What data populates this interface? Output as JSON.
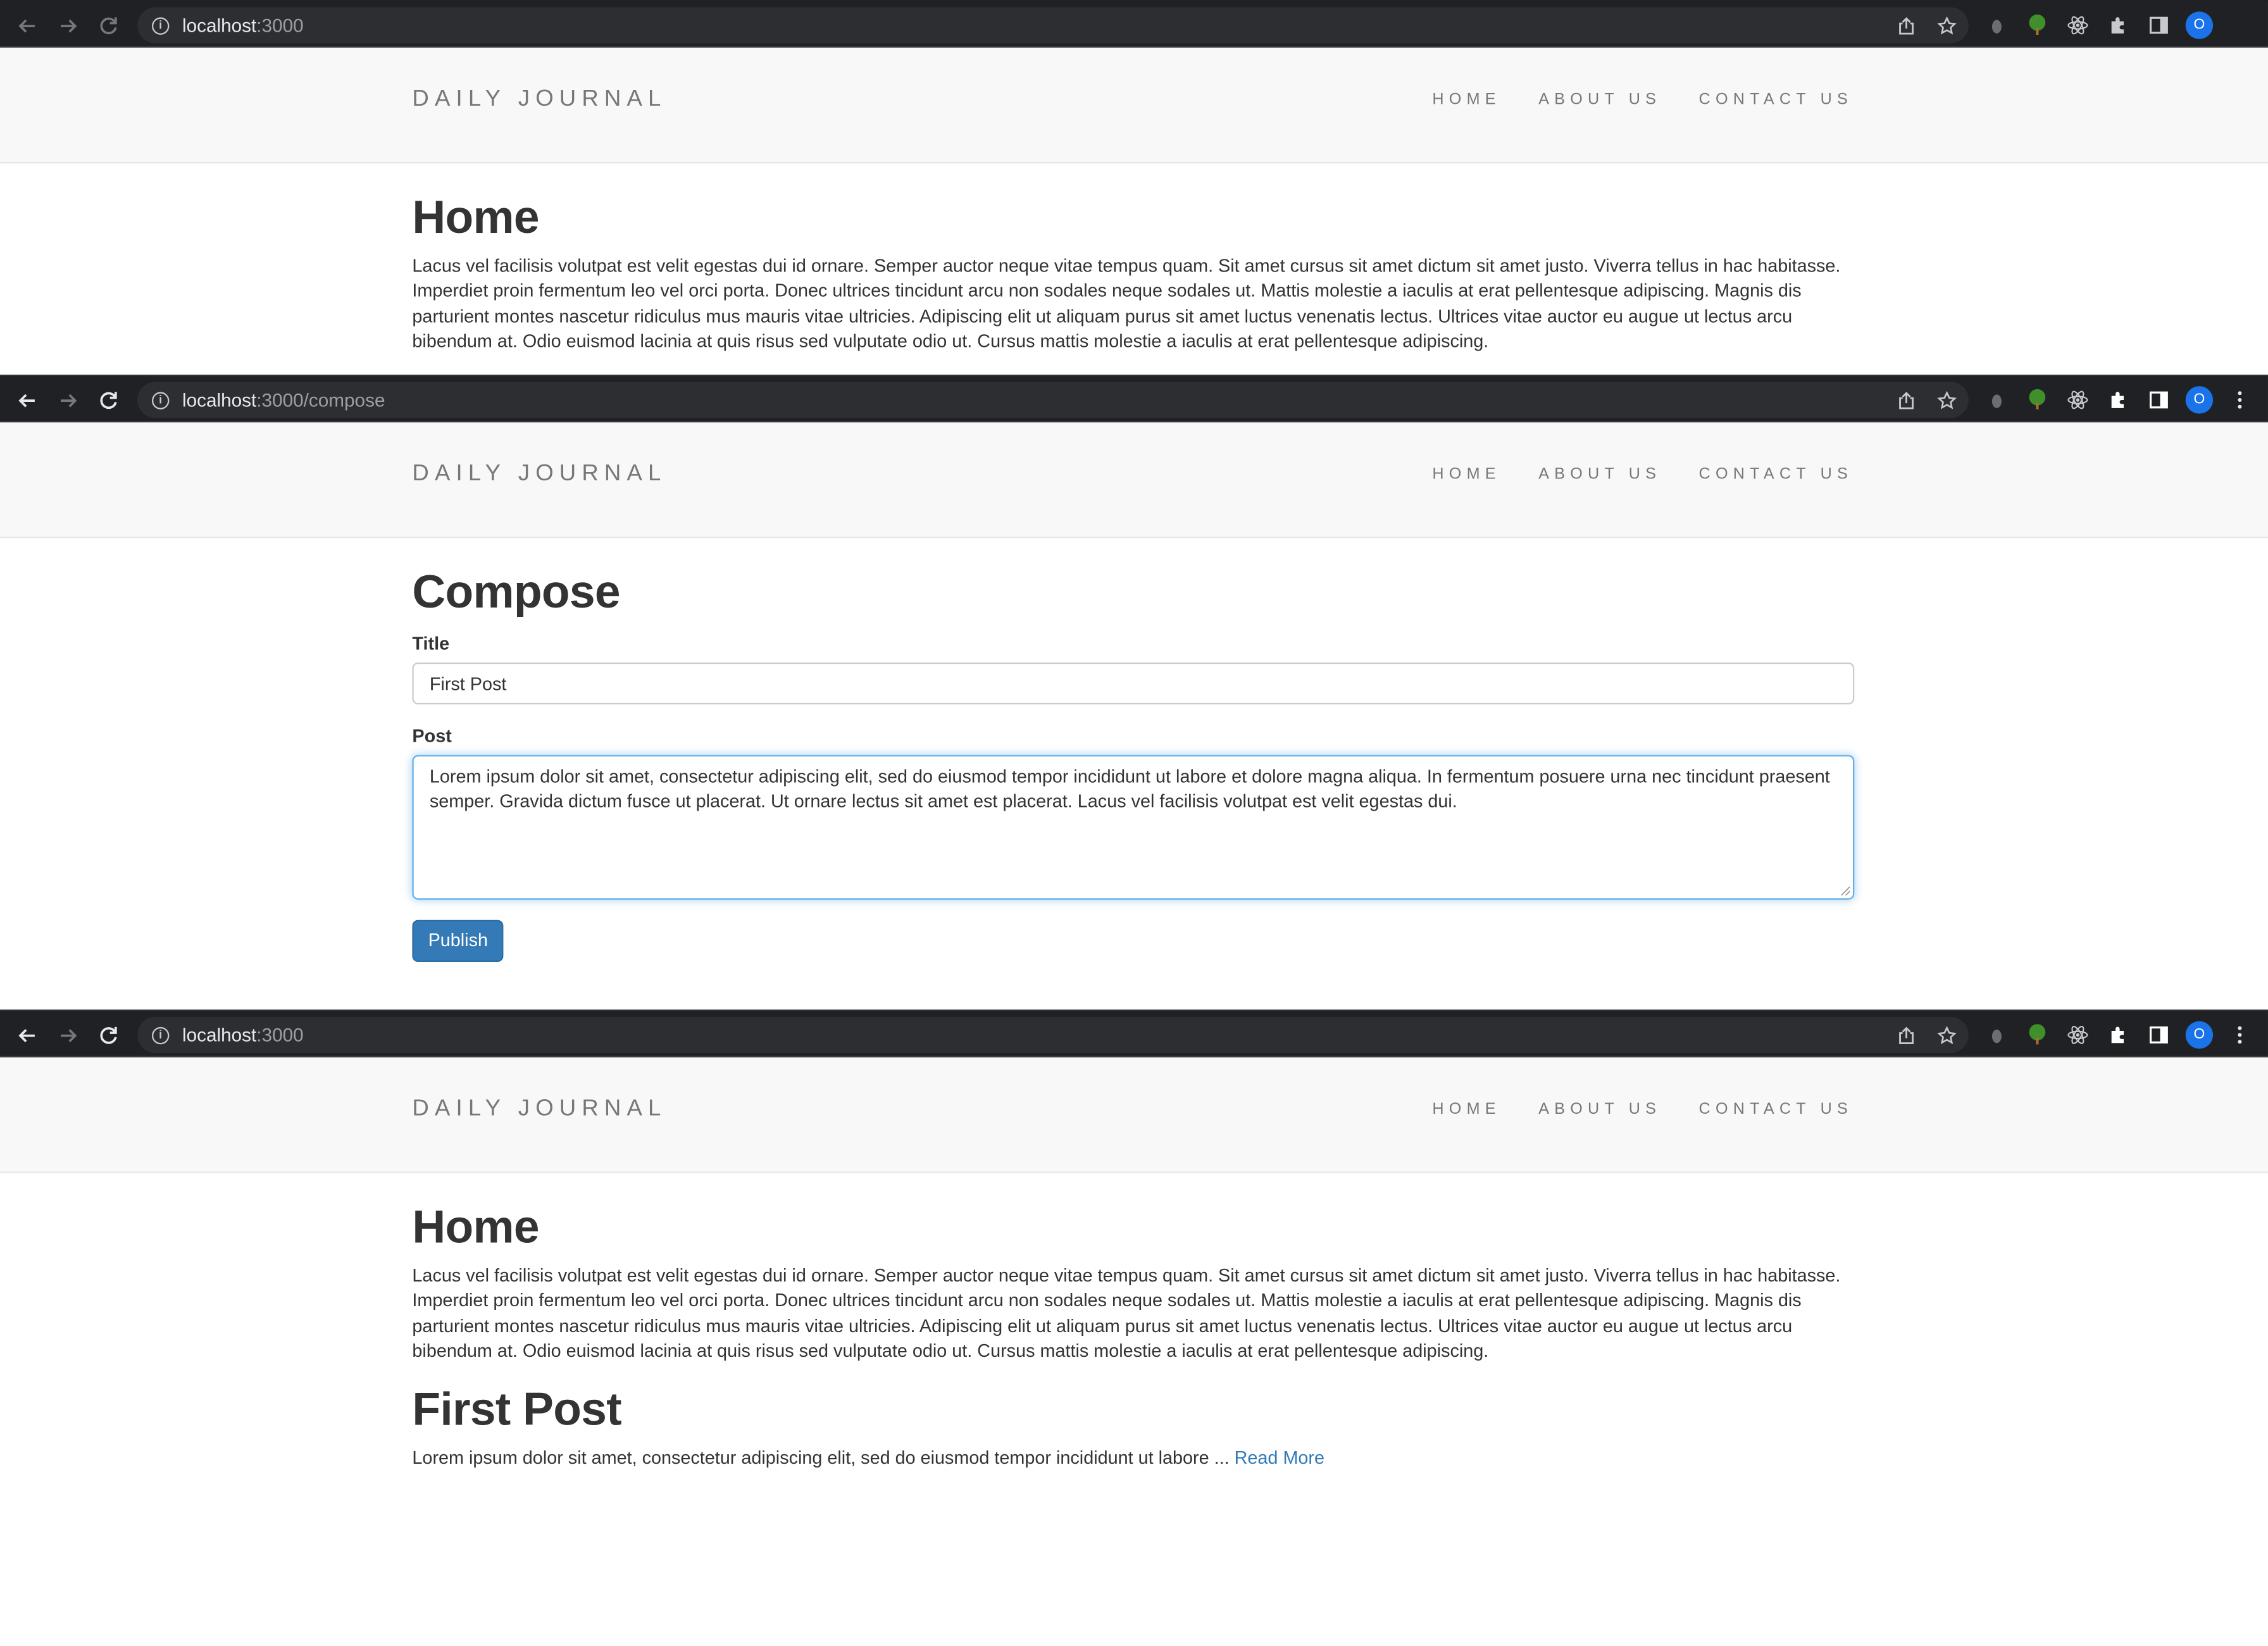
{
  "brand_title": "DAILY JOURNAL",
  "nav_links": [
    "HOME",
    "ABOUT US",
    "CONTACT US"
  ],
  "colors": {
    "chrome_bg": "#202124",
    "navbar_bg": "#f8f8f8",
    "link": "#337ab7",
    "button": "#337ab7",
    "heading": "#333333"
  },
  "home_content": "Lacus vel facilisis volutpat est velit egestas dui id ornare. Semper auctor neque vitae tempus quam. Sit amet cursus sit amet dictum sit amet justo. Viverra tellus in hac habitasse. Imperdiet proin fermentum leo vel orci porta. Donec ultrices tincidunt arcu non sodales neque sodales ut. Mattis molestie a iaculis at erat pellentesque adipiscing. Magnis dis parturient montes nascetur ridiculus mus mauris vitae ultricies. Adipiscing elit ut aliquam purus sit amet luctus venenatis lectus. Ultrices vitae auctor eu augue ut lectus arcu bibendum at. Odio euismod lacinia at quis risus sed vulputate odio ut. Cursus mattis molestie a iaculis at erat pellentesque adipiscing.",
  "window1": {
    "url_host": "localhost",
    "url_path": ":3000",
    "page_heading": "Home"
  },
  "window2": {
    "url_host": "localhost",
    "url_path": ":3000/compose",
    "page_heading": "Compose",
    "title_label": "Title",
    "title_value": "First Post",
    "post_label": "Post",
    "post_value": "Lorem ipsum dolor sit amet, consectetur adipiscing elit, sed do eiusmod tempor incididunt ut labore et dolore magna aliqua. In fermentum posuere urna nec tincidunt praesent semper. Gravida dictum fusce ut placerat. Ut ornare lectus sit amet est placerat. Lacus vel facilisis volutpat est velit egestas dui.",
    "publish_label": "Publish"
  },
  "window3": {
    "url_host": "localhost",
    "url_path": ":3000",
    "page_heading": "Home",
    "post_title": "First Post",
    "post_excerpt": "Lorem ipsum dolor sit amet, consectetur adipiscing elit, sed do eiusmod tempor incididunt ut labore ...",
    "read_more": "Read More"
  },
  "profile_initial": "O"
}
